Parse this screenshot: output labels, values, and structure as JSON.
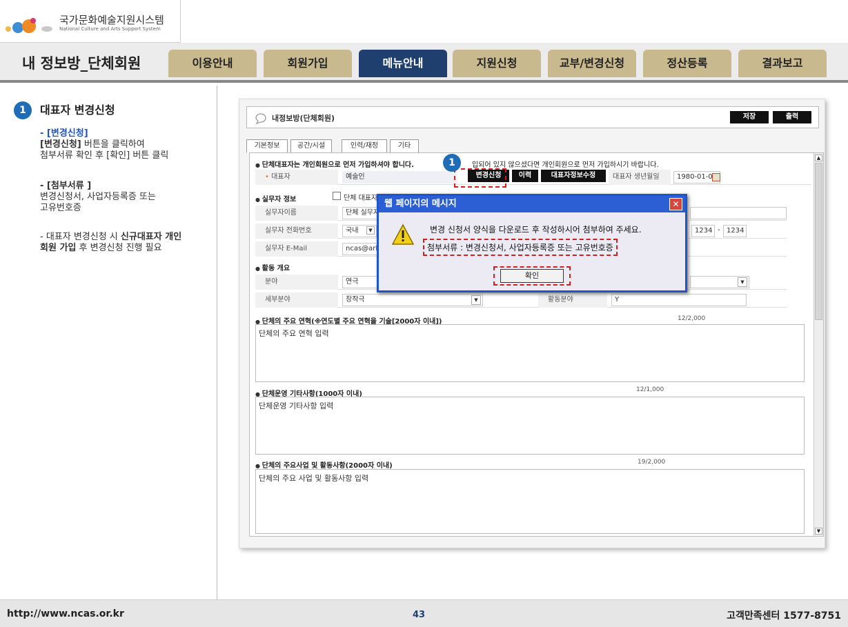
{
  "header": {
    "logo_title": "국가문화예술지원시스템",
    "logo_subtitle": "National Culture and Arts Support System",
    "page_title": "내 정보방_단체회원",
    "tabs": [
      {
        "label": "이용안내"
      },
      {
        "label": "회원가입"
      },
      {
        "label": "메뉴안내"
      },
      {
        "label": "지원신청"
      },
      {
        "label": "교부/변경신청"
      },
      {
        "label": "정산등록"
      },
      {
        "label": "결과보고"
      }
    ]
  },
  "left": {
    "step": "1",
    "title": "대표자 변경신청",
    "item1_head": "- [변경신청]",
    "item1_bold": "[변경신청]",
    "item1_text": " 버튼을 클릭하여",
    "item1_text2": "첨부서류 확인 후 [확인] 버튼 클릭",
    "item2_head": "- [첨부서류 ]",
    "item2_text": "변경신청서, 사업자등록증 또는",
    "item2_text2": "고유번호증",
    "item3_pre": "- 대표자 변경신청 시 ",
    "item3_bold": "신규대표자 개인",
    "item3_bold2": "회원 가입",
    "item3_post": " 후 변경신청 진행 필요"
  },
  "screen": {
    "title": "내정보방(단체회원)",
    "save_label": "저장",
    "print_label": "출력",
    "subtabs": [
      "기본정보",
      "공간/시설",
      "인력/재정",
      "기타"
    ],
    "notice": "단체대표자는 개인회원으로 먼저 가입하셔야 합니다.",
    "notice_tail": "입되어 있지 않으셨다면 개인회원으로 먼저 가입하시기 바랍니다.",
    "rep_label": "대표자",
    "rep_value": "예술인",
    "btn_change": "변경신청",
    "btn_history": "이력",
    "btn_rep_edit": "대표자정보수정",
    "birth_label": "대표자 생년월일",
    "birth_value": "1980-01-01",
    "staff_section": "실무자 정보",
    "staff_check_label": "단체 대표자",
    "staff_name_label": "실무자이름",
    "staff_name_value": "단체 실무자",
    "staff_phone_label": "실무자 전화번호",
    "staff_phone_country": "국내",
    "phone_mid": "1234",
    "phone_end": "1234",
    "staff_email_label": "실무자 E-Mail",
    "staff_email_value": "ncas@ark",
    "activity_section": "활동 개요",
    "field_label": "분야",
    "field_value": "연극",
    "subfield_label": "세부분야",
    "subfield_value": "창작극",
    "activity_field_label": "활동분야",
    "activity_field_value": "Y",
    "history_label": "단체의 주요 연혁(※연도별 주요 연혁을 기술[2000자 이내])",
    "history_count": "12/2,000",
    "history_value": "단체의 주요 연혁 입력",
    "etc_label": "단체운영 기타사항(1000자 이내)",
    "etc_count": "12/1,000",
    "etc_value": "단체운영 기타사항 입력",
    "business_label": "단체의 주요사업 및 활동사항(2000자 이내)",
    "business_count": "19/2,000",
    "business_value": "단체의 주요 사업 및 활동사항 입력",
    "step": "1"
  },
  "dialog": {
    "title": "웹 페이지의 메시지",
    "message": "변경 신청서 양식을 다운로드 후 작성하시어 첨부하여 주세요.",
    "attachment": "첨부서류 : 변경신청서, 사업자등록증 또는 고유번호증",
    "ok_label": "확인"
  },
  "footer": {
    "url": "http://www.ncas.or.kr",
    "page_number": "43",
    "support": "고객만족센터 1577-8751"
  },
  "colors": {
    "nav_active": "#1f3f6e",
    "nav_tab": "#c9b98e",
    "highlight": "#d21e1e",
    "step_circle": "#1e6db6",
    "dialog_blue": "#2c5fd3"
  }
}
